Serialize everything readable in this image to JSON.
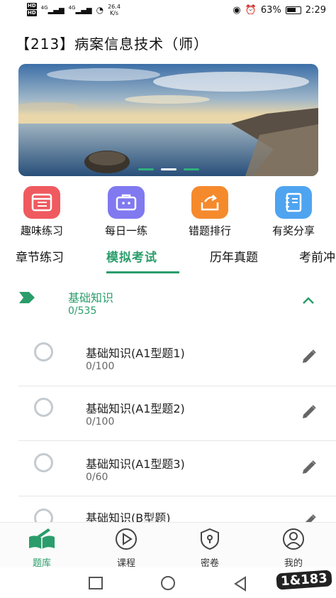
{
  "status_bar": {
    "hd_labels": [
      "HD",
      "HD"
    ],
    "signal_a": "4G",
    "signal_b": "4G",
    "net_speed": "26.4",
    "net_unit": "K/s",
    "battery": "63%",
    "time": "2:29"
  },
  "header": {
    "title": "【213】病案信息技术（师）"
  },
  "quick_actions": [
    {
      "label": "趣味练习",
      "icon": "calendar-list-icon",
      "color": "#ef5a5f"
    },
    {
      "label": "每日一练",
      "icon": "briefcase-icon",
      "color": "#8079f0"
    },
    {
      "label": "错题排行",
      "icon": "box-arrow-icon",
      "color": "#f58a2d"
    },
    {
      "label": "有奖分享",
      "icon": "notebook-icon",
      "color": "#4fa4f0"
    }
  ],
  "tabs": [
    "章节练习",
    "模拟考试",
    "历年真题",
    "考前冲"
  ],
  "active_tab": "模拟考试",
  "section": {
    "title": "基础知识",
    "count": "0/535"
  },
  "items": [
    {
      "name": "基础知识(A1型题1)",
      "count": "0/100"
    },
    {
      "name": "基础知识(A1型题2)",
      "count": "0/100"
    },
    {
      "name": "基础知识(A1型题3)",
      "count": "0/60"
    },
    {
      "name": "基础知识(B型题)",
      "count": ""
    }
  ],
  "bottom_nav": [
    {
      "label": "题库",
      "icon": "book-icon"
    },
    {
      "label": "课程",
      "icon": "play-icon"
    },
    {
      "label": "密卷",
      "icon": "lock-icon"
    },
    {
      "label": "我的",
      "icon": "user-icon"
    }
  ],
  "watermark": "1&183",
  "colors": {
    "accent": "#2a9d6b"
  }
}
